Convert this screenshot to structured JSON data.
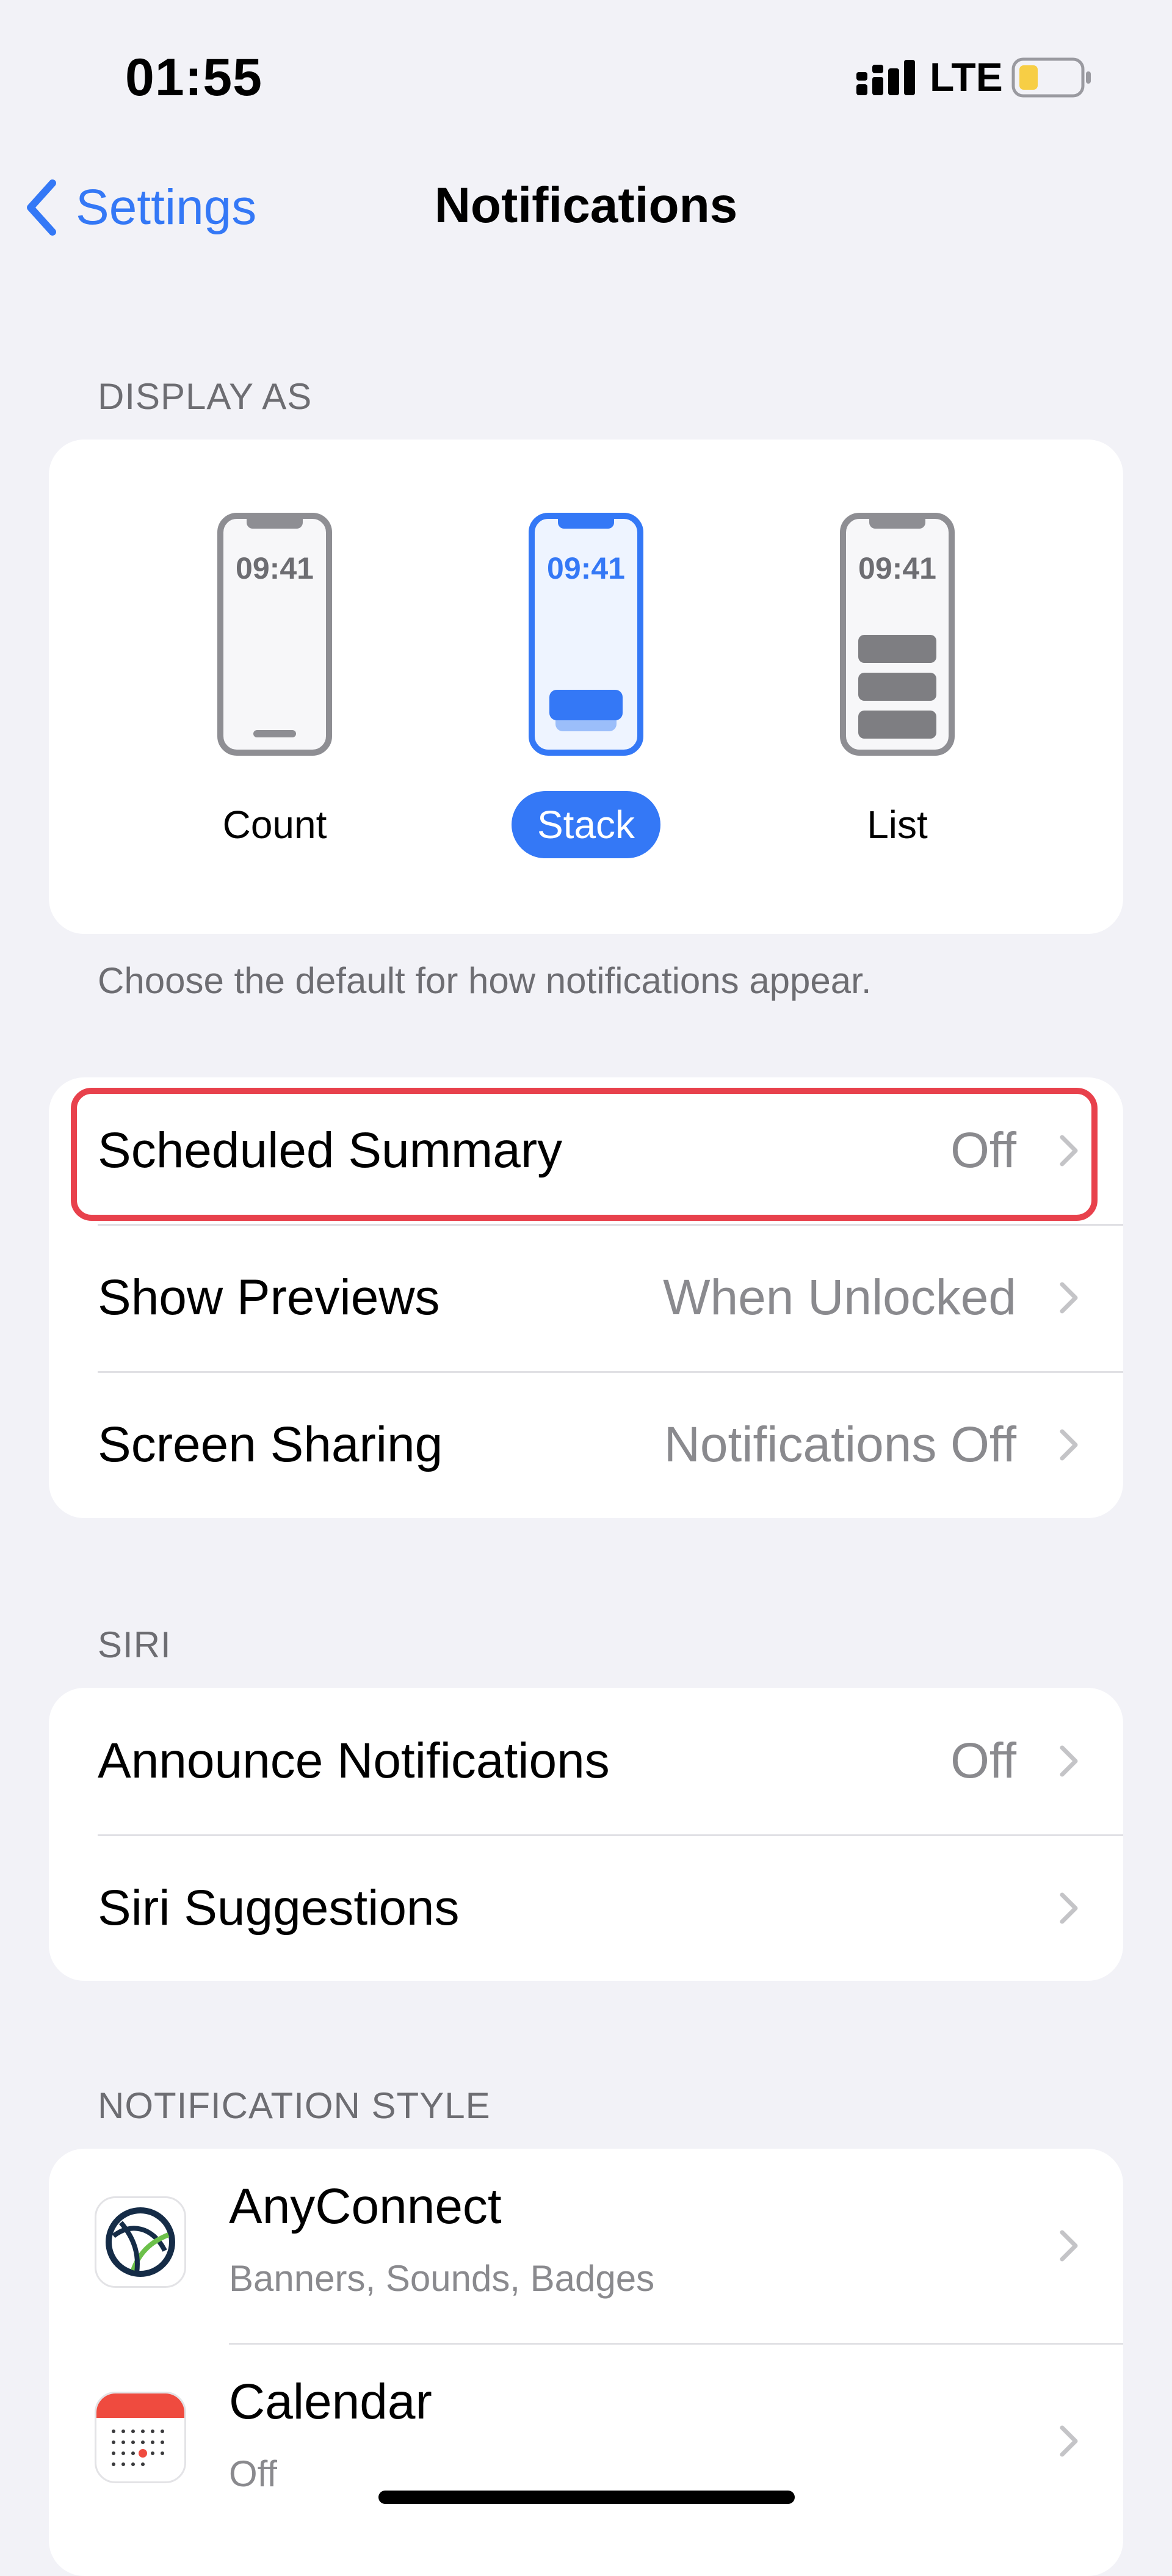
{
  "status_bar": {
    "time": "01:55",
    "network": "LTE"
  },
  "nav": {
    "back_label": "Settings",
    "title": "Notifications"
  },
  "display_as": {
    "header": "DISPLAY AS",
    "options": [
      {
        "label": "Count",
        "time": "09:41",
        "selected": false
      },
      {
        "label": "Stack",
        "time": "09:41",
        "selected": true
      },
      {
        "label": "List",
        "time": "09:41",
        "selected": false
      }
    ],
    "footer": "Choose the default for how notifications appear."
  },
  "settings": [
    {
      "label": "Scheduled Summary",
      "value": "Off"
    },
    {
      "label": "Show Previews",
      "value": "When Unlocked"
    },
    {
      "label": "Screen Sharing",
      "value": "Notifications Off"
    }
  ],
  "siri": {
    "header": "SIRI",
    "rows": [
      {
        "label": "Announce Notifications",
        "value": "Off"
      },
      {
        "label": "Siri Suggestions",
        "value": ""
      }
    ]
  },
  "notification_style": {
    "header": "NOTIFICATION STYLE",
    "apps": [
      {
        "name": "AnyConnect",
        "detail": "Banners, Sounds, Badges",
        "icon": "anyconnect-icon"
      },
      {
        "name": "Calendar",
        "detail": "Off",
        "icon": "calendar-icon"
      }
    ]
  },
  "colors": {
    "accent": "#3478F6",
    "highlight": "#E8414C",
    "background": "#F2F2F7"
  }
}
